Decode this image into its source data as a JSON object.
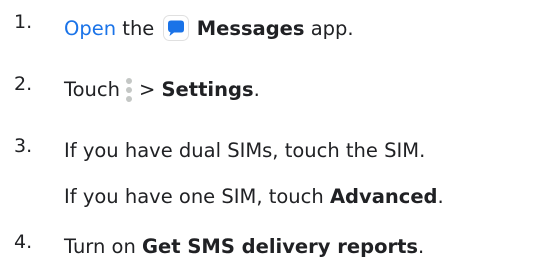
{
  "steps": [
    {
      "number": "1.",
      "link": "Open",
      "text_a": "the",
      "icon": "messages-app-icon",
      "bold": "Messages",
      "text_b": "app."
    },
    {
      "number": "2.",
      "text_a": "Touch",
      "icon": "more-vertical-icon",
      "separator": ">",
      "bold": "Settings",
      "text_b": "."
    },
    {
      "number": "3.",
      "text_a": "If you have dual SIMs, touch the SIM.",
      "text_b": "If you have one SIM, touch",
      "bold": "Advanced",
      "text_c": "."
    },
    {
      "number": "4.",
      "text_a": "Turn on",
      "bold": "Get SMS delivery reports",
      "text_b": "."
    }
  ],
  "colors": {
    "link": "#1a73e8",
    "icon_blue": "#1a73e8",
    "text": "#202124",
    "menu_dots": "#c4c7c5"
  }
}
